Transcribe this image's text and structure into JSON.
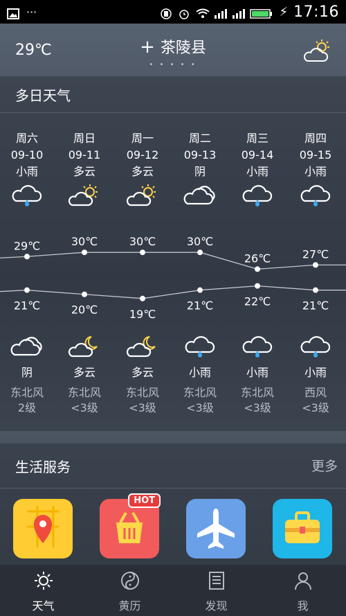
{
  "status_bar": {
    "time": "17:16"
  },
  "header": {
    "current_temp": "29℃",
    "city": "茶陵县",
    "page_dots": "• • • • •"
  },
  "multi_day": {
    "title": "多日天气",
    "days": [
      {
        "weekday": "周六",
        "date": "09-10",
        "day_condition": "小雨",
        "day_icon": "rain-icon",
        "high": "29℃",
        "low": "21℃",
        "night_icon": "cloudy-icon",
        "night_condition": "阴",
        "wind_dir": "东北风",
        "wind_level": "2级"
      },
      {
        "weekday": "周日",
        "date": "09-11",
        "day_condition": "多云",
        "day_icon": "partly-sunny-icon",
        "high": "30℃",
        "low": "20℃",
        "night_icon": "partly-cloudy-night-icon",
        "night_condition": "多云",
        "wind_dir": "东北风",
        "wind_level": "<3级"
      },
      {
        "weekday": "周一",
        "date": "09-12",
        "day_condition": "多云",
        "day_icon": "partly-sunny-icon",
        "high": "30℃",
        "low": "19℃",
        "night_icon": "partly-cloudy-night-icon",
        "night_condition": "多云",
        "wind_dir": "东北风",
        "wind_level": "<3级"
      },
      {
        "weekday": "周二",
        "date": "09-13",
        "day_condition": "阴",
        "day_icon": "cloudy-icon",
        "high": "30℃",
        "low": "21℃",
        "night_icon": "rain-icon",
        "night_condition": "小雨",
        "wind_dir": "东北风",
        "wind_level": "<3级"
      },
      {
        "weekday": "周三",
        "date": "09-14",
        "day_condition": "小雨",
        "day_icon": "rain-icon",
        "high": "26℃",
        "low": "22℃",
        "night_icon": "rain-icon",
        "night_condition": "小雨",
        "wind_dir": "东北风",
        "wind_level": "<3级"
      },
      {
        "weekday": "周四",
        "date": "09-15",
        "day_condition": "小雨",
        "day_icon": "rain-icon",
        "high": "27℃",
        "low": "21℃",
        "night_icon": "rain-icon",
        "night_condition": "小雨",
        "wind_dir": "西风",
        "wind_level": "<3级"
      }
    ]
  },
  "life_services": {
    "title": "生活服务",
    "more_label": "更多",
    "apps": [
      {
        "icon": "map-pin-icon",
        "color": "#ffcc33"
      },
      {
        "icon": "shopping-basket-icon",
        "color": "#f25b5b",
        "badge": "HOT"
      },
      {
        "icon": "airplane-icon",
        "color": "#6aa0e8"
      },
      {
        "icon": "briefcase-icon",
        "color": "#1fb6e8"
      }
    ]
  },
  "bottom_nav": {
    "items": [
      {
        "label": "天气",
        "icon": "sun-icon",
        "active": true
      },
      {
        "label": "黄历",
        "icon": "yin-yang-icon",
        "active": false
      },
      {
        "label": "发现",
        "icon": "news-icon",
        "active": false
      },
      {
        "label": "我",
        "icon": "person-icon",
        "active": false
      }
    ]
  }
}
